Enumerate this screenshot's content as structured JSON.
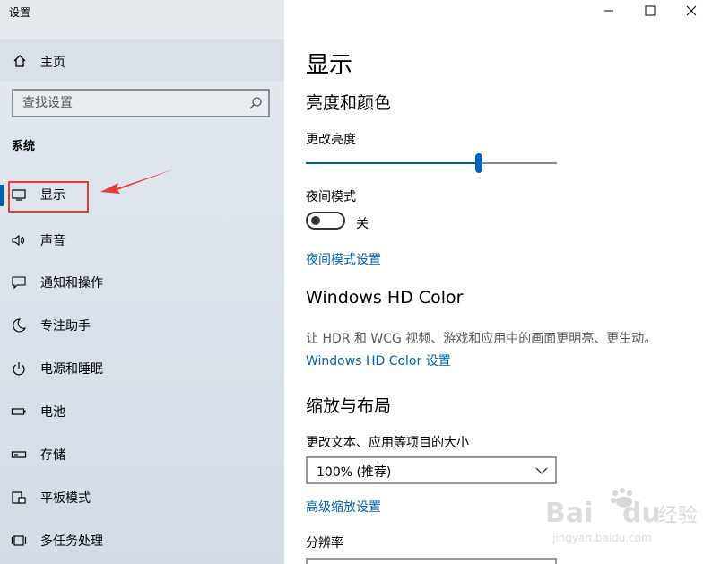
{
  "window": {
    "title": "设置"
  },
  "sidebar": {
    "home_label": "主页",
    "search_placeholder": "查找设置",
    "section_label": "系统",
    "items": [
      {
        "label": "显示",
        "icon": "monitor-icon"
      },
      {
        "label": "声音",
        "icon": "speaker-icon"
      },
      {
        "label": "通知和操作",
        "icon": "notification-icon"
      },
      {
        "label": "专注助手",
        "icon": "moon-icon"
      },
      {
        "label": "电源和睡眠",
        "icon": "power-icon"
      },
      {
        "label": "电池",
        "icon": "battery-icon"
      },
      {
        "label": "存储",
        "icon": "storage-icon"
      },
      {
        "label": "平板模式",
        "icon": "tablet-icon"
      },
      {
        "label": "多任务处理",
        "icon": "multitask-icon"
      }
    ]
  },
  "content": {
    "page_title": "显示",
    "brightness_header": "亮度和颜色",
    "brightness_label": "更改亮度",
    "brightness_level": 0.69,
    "night_light_label": "夜间模式",
    "night_light_state": "关",
    "night_light_link": "夜间模式设置",
    "hdr_header": "Windows HD Color",
    "hdr_desc": "让 HDR 和 WCG 视频、游戏和应用中的画面更明亮、更生动。",
    "hdr_link": "Windows HD Color 设置",
    "scale_header": "缩放与布局",
    "scale_label": "更改文本、应用等项目的大小",
    "scale_value": "100% (推荐)",
    "advanced_scale_link": "高级缩放设置",
    "resolution_label": "分辨率"
  },
  "colors": {
    "accent": "#0063b1",
    "highlight": "#e33a3a"
  },
  "watermark": {
    "brand": "Baidu",
    "brand_cn": "经验",
    "url": "jingyan.baidu.com"
  }
}
